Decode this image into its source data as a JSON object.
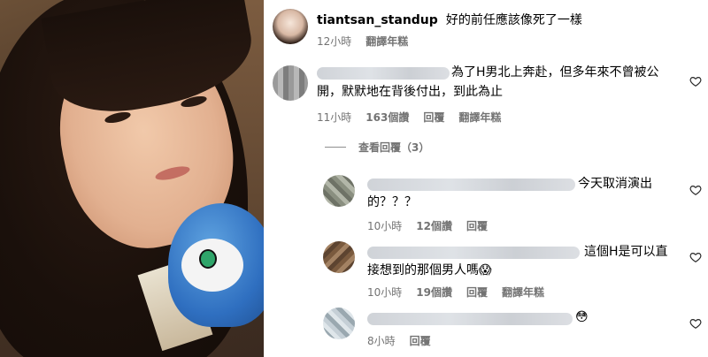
{
  "post": {
    "username": "tiantsan_standup",
    "caption": "好的前任應該像死了一樣",
    "time": "12小時",
    "translate": "翻譯年糕"
  },
  "comments": [
    {
      "text_line1": "為了H男北上奔赴，但多年來不曾被公",
      "text_line2": "開，默默地在背後付出，到此為止",
      "time": "11小時",
      "likes": "163個讚",
      "reply": "回覆",
      "translate": "翻譯年糕"
    }
  ],
  "view_replies": "查看回覆（3）",
  "replies": [
    {
      "text_line1": "今天取消演出",
      "text_line2": "的？？？",
      "time": "10小時",
      "likes": "12個讚",
      "reply": "回覆"
    },
    {
      "text_line1": "這個H是可以直",
      "text_line2": "接想到的那個男人嗎😱",
      "time": "10小時",
      "likes": "19個讚",
      "reply": "回覆",
      "translate": "翻譯年糕"
    },
    {
      "text_line1": "😳",
      "time": "8小時",
      "reply": "回覆"
    }
  ],
  "icons": {
    "heart": "heart-outline-icon"
  },
  "colors": {
    "meta_text": "#737373",
    "primary_text": "#000000"
  }
}
